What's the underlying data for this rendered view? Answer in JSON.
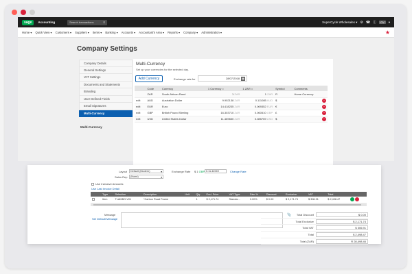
{
  "colors": {
    "accent": "#0b5fb0",
    "brand": "#00a650",
    "danger": "#d9213c",
    "topbar": "#1e1e1e"
  },
  "window": {
    "dots": [
      "#ff5f57",
      "#d9213c",
      "#cfcfcf"
    ]
  },
  "topbar": {
    "logo": "sage",
    "app_name": "Accounting",
    "search_placeholder": "Search transactions",
    "company": "SuperCycle Wholesales",
    "avatar": "CV"
  },
  "nav": {
    "items": [
      "Home",
      "Quick View",
      "Customers",
      "Suppliers",
      "Items",
      "Banking",
      "Accounts",
      "Accountant's Area",
      "Reports",
      "Company",
      "Administration"
    ]
  },
  "page": {
    "title": "Company Settings"
  },
  "sidebar": {
    "items": [
      "Company Details",
      "General Settings",
      "VAT Settings",
      "Documents and Statements",
      "Branding",
      "User Defined Fields",
      "Email Signatures",
      "Multi-Currency"
    ],
    "active": "Multi-Currency",
    "sub_label": "Multi-Currency"
  },
  "currency_panel": {
    "title": "Multi-Currency",
    "subtitle": "Set up your currencies for the selected day.",
    "add_button": "Add Currency",
    "exchange_label": "Exchange rate for",
    "exchange_date": "28/07/2018",
    "columns": [
      "",
      "Code",
      "Currency",
      "1 Currency =",
      "1 ZAR =",
      "Symbol",
      "Comments"
    ],
    "rows": [
      {
        "edit": "",
        "code": "ZAR",
        "name": "South African Rand",
        "rate": "1",
        "rate_unit": "ZAR",
        "inverse": "1",
        "inverse_unit": "ZAR",
        "symbol": "R",
        "comment": "Home Currency",
        "deletable": false
      },
      {
        "edit": "edit",
        "code": "AUD",
        "name": "Australian Dollar",
        "rate": "9.902138",
        "rate_unit": "ZAR",
        "inverse": "0.111085",
        "inverse_unit": "AUD",
        "symbol": "$",
        "comment": "",
        "deletable": true
      },
      {
        "edit": "edit",
        "code": "EUR",
        "name": "Euro",
        "rate": "14.418235",
        "rate_unit": "ZAR",
        "inverse": "0.069352",
        "inverse_unit": "EUR",
        "symbol": "€",
        "comment": "",
        "deletable": true
      },
      {
        "edit": "edit",
        "code": "GBP",
        "name": "British Pound Sterling",
        "rate": "16.303710",
        "rate_unit": "ZAR",
        "inverse": "0.060510",
        "inverse_unit": "GBP",
        "symbol": "£",
        "comment": "",
        "deletable": true
      },
      {
        "edit": "edit",
        "code": "USD",
        "name": "United States Dollar",
        "rate": "11.469650",
        "rate_unit": "ZAR",
        "inverse": "0.085759",
        "inverse_unit": "USD",
        "symbol": "$",
        "comment": "",
        "deletable": true
      }
    ]
  },
  "invoice": {
    "layout_label": "Layout",
    "layout_value": "Default (Modern)",
    "sales_rep_label": "Sales Rep",
    "sales_rep_value": "(None)",
    "exchange_label": "Exchange Rate",
    "exchange_currency": "$ 1 ",
    "exchange_currency_unit": "GBP",
    "exchange_value": "0.11.44949",
    "exchange_link": "Change Rate",
    "inclusive_label": "Use Inclusive Amounts",
    "last_invoice_link": "Use Last Invoice Detail",
    "columns": [
      "",
      "Type",
      "Selection",
      "Description",
      "Unit",
      "Qty",
      "Excl. Price",
      "VAT Type",
      "Disc %",
      "Discount",
      "Exclusive",
      "VAT",
      "Total",
      ""
    ],
    "rows": [
      {
        "check": "",
        "type": "Item",
        "selection": "TLAMBO-V01",
        "description": "*Carbon Road Frame",
        "unit": "",
        "qty": "1",
        "price": "$ 2,171.74",
        "vat_type": "Standar...",
        "disc": "0.00%",
        "discount": "$ 0.00",
        "exclusive": "$ 2,171.74",
        "vat": "$ 306.91",
        "total": "$ 2,498.47"
      }
    ],
    "message_label": "Message",
    "default_message_link": "Set Default Message",
    "attach_icon": "paperclip-icon",
    "totals": [
      {
        "label": "Total Discount",
        "value": "$ 0.00"
      },
      {
        "label": "Total Exclusive",
        "value": "$ 2,171.74"
      },
      {
        "label": "Total VAT",
        "value": "$ 306.91"
      },
      {
        "label": "Total",
        "value": "$ 2,498.47"
      },
      {
        "label": "Total (ZAR)",
        "value": "R 28,498.46"
      }
    ]
  }
}
